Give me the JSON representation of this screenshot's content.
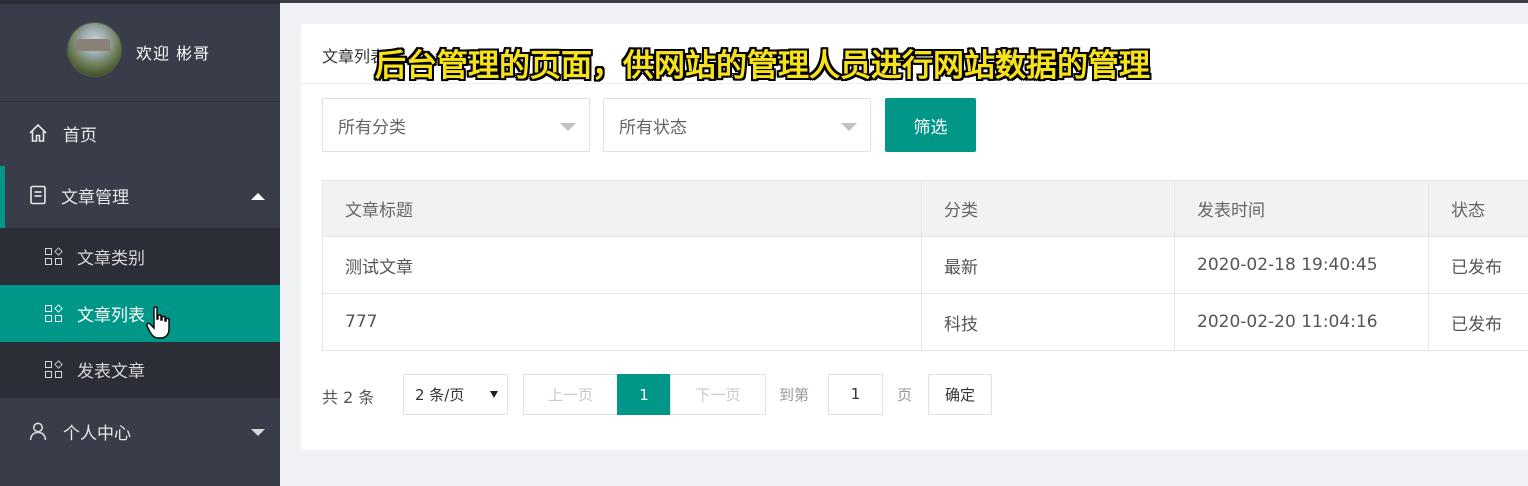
{
  "user": {
    "welcome": "欢迎  彬哥"
  },
  "menu": {
    "home": "首页",
    "article_management": "文章管理",
    "submenu": [
      "文章类别",
      "文章列表",
      "发表文章"
    ],
    "profile": "个人中心"
  },
  "card": {
    "title": "文章列表"
  },
  "filters": {
    "category": "所有分类",
    "status": "所有状态",
    "filter_button": "筛选"
  },
  "table": {
    "headers": [
      "文章标题",
      "分类",
      "发表时间",
      "状态"
    ],
    "rows": [
      [
        "测试文章",
        "最新",
        "2020-02-18 19:40:45",
        "已发布"
      ],
      [
        "777",
        "科技",
        "2020-02-20 11:04:16",
        "已发布"
      ]
    ]
  },
  "pagination": {
    "total": "共 2 条",
    "per_page": "2 条/页",
    "prev": "上一页",
    "current": "1",
    "next": "下一页",
    "goto_label": "到第",
    "goto_value": "1",
    "page_label": "页",
    "confirm": "确定"
  },
  "caption": "后台管理的页面，供网站的管理人员进行网站数据的管理",
  "colors": {
    "accent": "#009688",
    "sidebar": "#393d49",
    "submenu": "#2b2e37",
    "caption": "#f7e21a"
  }
}
